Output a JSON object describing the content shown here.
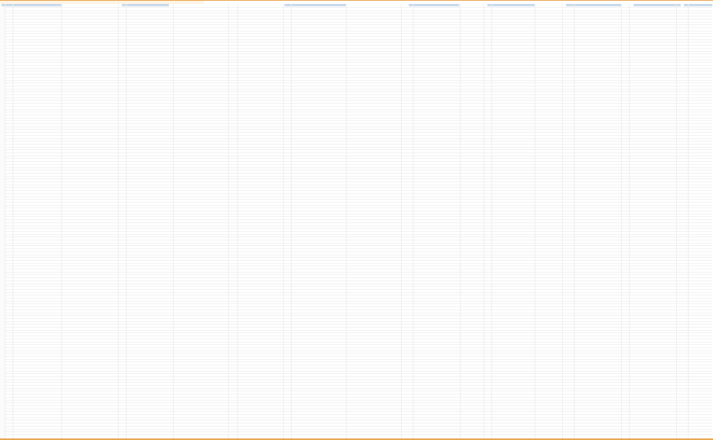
{
  "sheet": {
    "title": "",
    "accent_color": "#e8a24a",
    "header_color": "#c7d9ea",
    "column_headers": [
      {
        "label": ""
      },
      {
        "label": ""
      },
      {
        "label": ""
      },
      {
        "label": ""
      },
      {
        "label": ""
      },
      {
        "label": ""
      },
      {
        "label": ""
      },
      {
        "label": ""
      }
    ]
  },
  "grid": {
    "rows": 150,
    "columns": 10
  }
}
